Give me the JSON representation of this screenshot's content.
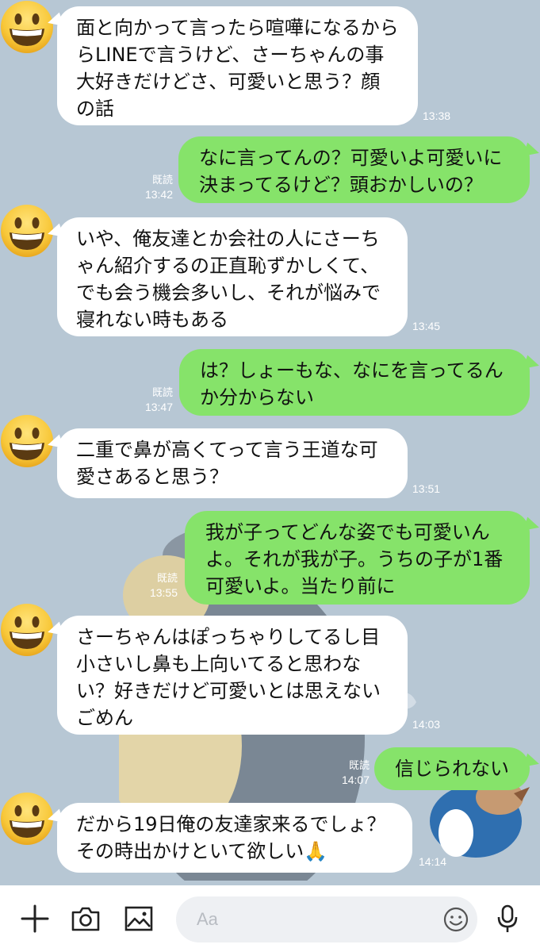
{
  "messages": [
    {
      "text": "面と向かって言ったら喧嘩になるから\nらLINEで言うけど、さーちゃんの事\n大好きだけどさ、可愛いと思う？顔\nの話",
      "time": "13:38"
    },
    {
      "text": "なに言ってんの？可愛いよ可愛いに\n決まってるけど？頭おかしいの？",
      "time": "13:42",
      "read": "既読"
    },
    {
      "text": "いや、俺友達とか会社の人にさーち\nゃん紹介するの正直恥ずかしくて、\nでも会う機会多いし、それが悩みで\n寝れない時もある",
      "time": "13:45"
    },
    {
      "text": "は？しょーもな、なにを言ってるん\nか分からない",
      "time": "13:47",
      "read": "既読"
    },
    {
      "text": "二重で鼻が高くてって言う王道な可\n愛さあると思う？",
      "time": "13:51"
    },
    {
      "text": "我が子ってどんな姿でも可愛いん\nよ。それが我が子。うちの子が1番\n可愛いよ。当たり前に",
      "time": "13:55",
      "read": "既読"
    },
    {
      "text": "さーちゃんはぽっちゃりしてるし目\n小さいし鼻も上向いてると思わな\nい？好きだけど可愛いとは思えない\nごめん",
      "time": "14:03"
    },
    {
      "text": "信じられない",
      "time": "14:07",
      "read": "既読"
    },
    {
      "text": "だから19日俺の友達家来るでしょ？\nその時出かけといて欲しい🙏",
      "time": "14:14"
    }
  ],
  "input": {
    "placeholder": "Aa"
  },
  "icons": {
    "add": "plus-icon",
    "camera": "camera-icon",
    "image": "image-icon",
    "emoji": "smiley-icon",
    "mic": "microphone-icon",
    "avatar": "grinning-face-emoji"
  },
  "colors": {
    "background": "#b7c7d4",
    "incoming_bubble": "#ffffff",
    "outgoing_bubble": "#86e36a"
  }
}
